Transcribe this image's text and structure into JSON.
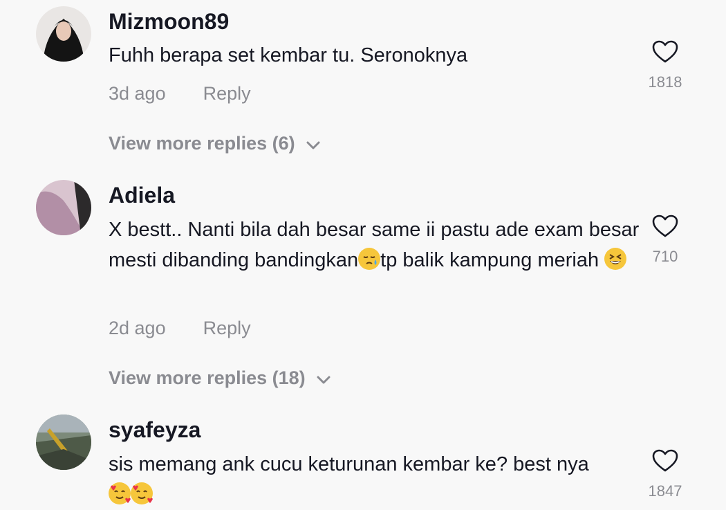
{
  "comments": [
    {
      "username": "Mizmoon89",
      "text": "Fuhh berapa set kembar tu. Seronoknya",
      "time": "3d ago",
      "reply": "Reply",
      "likes": "1818",
      "view_more": "View more replies (6)",
      "avatar_icon": "user-avatar-hijab"
    },
    {
      "username": "Adiela",
      "text_parts": [
        "X bestt.. Nanti bila dah besar same ii pastu ade exam besar mesti dibanding bandingkan",
        "tp balik kampung meriah "
      ],
      "time": "2d ago",
      "reply": "Reply",
      "likes": "710",
      "view_more": "View more replies (18)",
      "avatar_icon": "user-avatar-purple"
    },
    {
      "username": "syafeyza",
      "text": "sis memang ank cucu keturunan kembar ke? best nya",
      "likes": "1847",
      "avatar_icon": "user-avatar-landscape"
    }
  ],
  "colors": {
    "background": "#f8f8f8",
    "text": "#161823",
    "secondary": "#8a8b91"
  },
  "icons": [
    "heart-outline-icon",
    "chevron-down-icon",
    "sleepy-face-emoji",
    "grinning-squint-emoji",
    "smiling-face-with-hearts-emoji"
  ]
}
